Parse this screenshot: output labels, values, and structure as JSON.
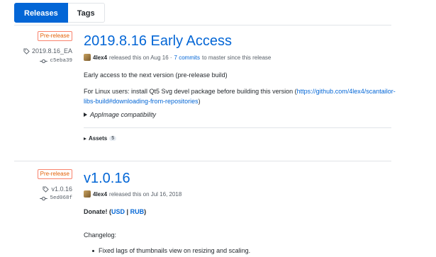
{
  "tabs": [
    {
      "label": "Releases",
      "active": true
    },
    {
      "label": "Tags",
      "active": false
    }
  ],
  "releases": [
    {
      "badge": "Pre-release",
      "tag": "2019.8.16_EA",
      "commit": "c5eba39",
      "title": "2019.8.16 Early Access",
      "author": "4lex4",
      "released_text": "released this on Aug 16 ·",
      "commits_link": "7 commits",
      "commits_suffix": "to master since this release",
      "body_line1": "Early access to the next version (pre-release build)",
      "body_line2_prefix": "For Linux users: install Qt5 Svg devel package before building this version (",
      "body_line2_link": "https://github.com/4lex4/scantailor-libs-build#downloading-from-repositories",
      "body_line2_suffix": ")",
      "details_summary": "AppImage compatibility",
      "assets_label": "Assets",
      "assets_count": "5"
    },
    {
      "badge": "Pre-release",
      "tag": "v1.0.16",
      "commit": "5ed068f",
      "title": "v1.0.16",
      "author": "4lex4",
      "released_text": "released this on Jul 16, 2018",
      "donate_label": "Donate!",
      "donate_open": "(",
      "donate_usd": "USD",
      "donate_sep": "|",
      "donate_rub": "RUB",
      "donate_close": ")",
      "changelog_label": "Changelog:",
      "changelog_items": [
        "Fixed lags of thumbnails view on resizing and scaling."
      ]
    }
  ],
  "colors": {
    "accent": "#0366d6",
    "prerelease": "#e36209"
  }
}
